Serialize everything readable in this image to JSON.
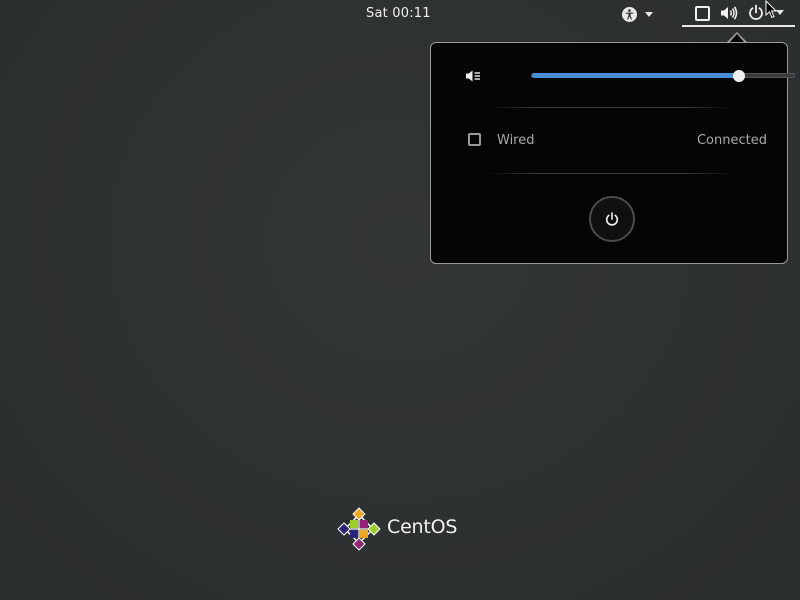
{
  "topbar": {
    "clock": "Sat 00:11",
    "icons": [
      "accessibility-icon",
      "chevron-down-icon",
      "network-wired-icon",
      "volume-icon",
      "power-icon",
      "chevron-down-icon"
    ]
  },
  "system_menu": {
    "volume": {
      "icon": "volume-muted-icon",
      "level": 0.79,
      "accent_color": "#4a90d9"
    },
    "network": {
      "icon": "network-wired-icon",
      "label": "Wired",
      "status": "Connected"
    },
    "power_button": {
      "icon": "power-icon"
    }
  },
  "branding": {
    "logo_text": "CentOS",
    "colors": [
      "#9ccd2a",
      "#932279",
      "#efa724",
      "#262577"
    ]
  }
}
